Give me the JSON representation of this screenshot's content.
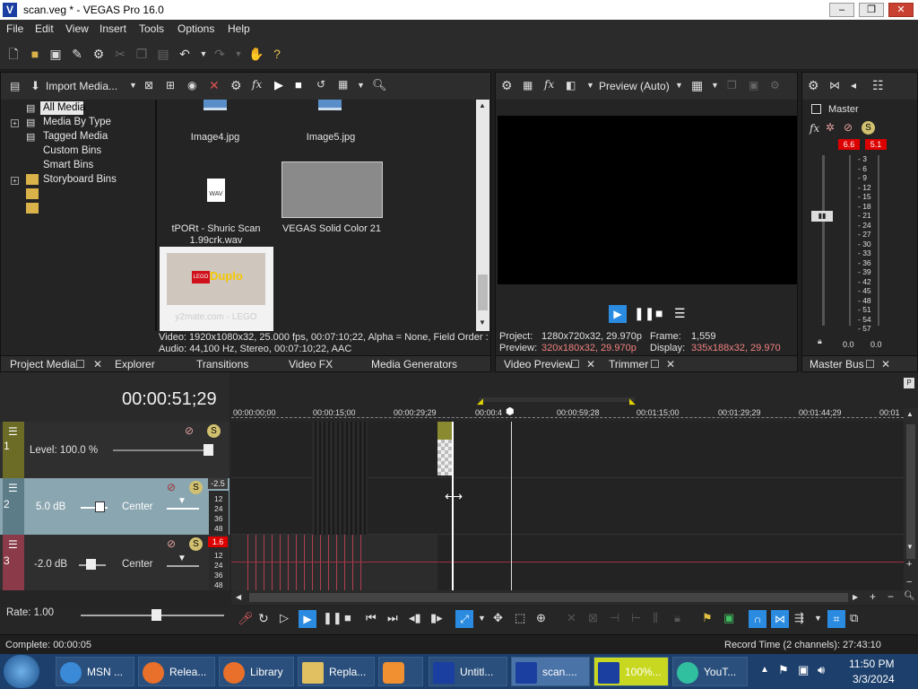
{
  "window": {
    "title": "scan.veg * - VEGAS Pro 16.0"
  },
  "menu": [
    "File",
    "Edit",
    "View",
    "Insert",
    "Tools",
    "Options",
    "Help"
  ],
  "project_media": {
    "import_label": "Import Media...",
    "tree": [
      "All Media",
      "Media By Type",
      "Tagged Media",
      "Custom Bins",
      "Smart Bins",
      "Storyboard Bins"
    ],
    "thumbs": [
      {
        "caption": "Image4.jpg"
      },
      {
        "caption": "Image5.jpg"
      },
      {
        "caption": "tPORt - Shuric Scan 1.99crk.wav"
      },
      {
        "caption": "VEGAS Solid Color 21"
      },
      {
        "caption": "y2mate.com - LEGO"
      }
    ],
    "info_video": "Video: 1920x1080x32, 25.000 fps, 00:07:10;22, Alpha = None, Field Order :",
    "info_audio": "Audio: 44,100 Hz, Stereo, 00:07:10;22, AAC",
    "lego_brand": "LEGO",
    "duplo_brand": "Duplo"
  },
  "left_tabs": [
    "Project Media",
    "Explorer",
    "Transitions",
    "Video FX",
    "Media Generators"
  ],
  "preview": {
    "mode": "Preview (Auto)",
    "project_label": "Project:",
    "project_value": "1280x720x32, 29.970p",
    "frame_label": "Frame:",
    "frame_value": "1,559",
    "preview_label": "Preview:",
    "preview_value": "320x180x32, 29.970p",
    "display_label": "Display:",
    "display_value": "335x188x32, 29.970"
  },
  "preview_tabs": [
    "Video Preview",
    "Trimmer"
  ],
  "master": {
    "label": "Master",
    "peak_left": "6.6",
    "peak_right": "5.1",
    "scale": [
      "3",
      "6",
      "9",
      "12",
      "15",
      "18",
      "21",
      "24",
      "27",
      "30",
      "33",
      "36",
      "39",
      "42",
      "45",
      "48",
      "51",
      "54",
      "57"
    ],
    "bottom_left": "0.0",
    "bottom_right": "0.0",
    "tab": "Master Bus"
  },
  "timeline": {
    "timecode": "00:00:51;29",
    "ruler": [
      "00:00:00;00",
      "00:00:15;00",
      "00:00:29;29",
      "00:00:4",
      "00:00:59;28",
      "00:01:15;00",
      "00:01:29;29",
      "00:01:44;29",
      "00:01"
    ],
    "tracks": [
      {
        "num": "1",
        "level": "Level: 100.0 %"
      },
      {
        "num": "2",
        "vol": "5.0 dB",
        "pan": "Center",
        "peak": "-2.5",
        "scale": [
          "12",
          "24",
          "36",
          "48"
        ]
      },
      {
        "num": "3",
        "vol": "-2.0 dB",
        "pan": "Center",
        "peak": "1.6",
        "scale": [
          "12",
          "24",
          "36",
          "48"
        ]
      }
    ],
    "rate": "Rate: 1.00"
  },
  "status": {
    "left": "Complete: 00:00:05",
    "right": "Record Time (2 channels): 27:43:10"
  },
  "taskbar": {
    "items": [
      "MSN ...",
      "Relea...",
      "Library",
      "Repla...",
      "",
      "Untitl...",
      "scan....",
      "100%...",
      "YouT..."
    ],
    "time": "11:50 PM",
    "date": "3/3/2024"
  }
}
